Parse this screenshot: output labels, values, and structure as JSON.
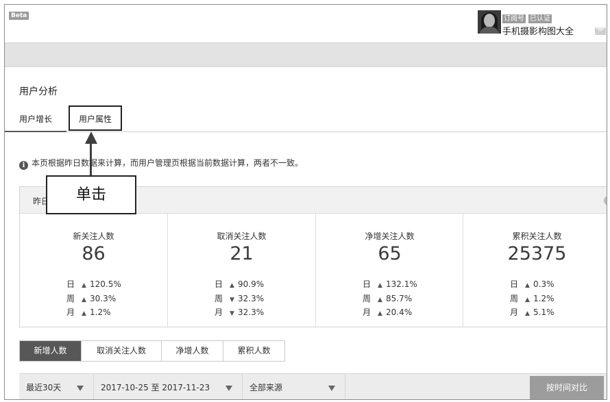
{
  "header": {
    "beta_label": "Beta",
    "tags": [
      "订阅号",
      "已认证"
    ],
    "account_name": "手机摄影构图大全"
  },
  "page_title": "用户分析",
  "tabs": [
    {
      "label": "用户增长"
    },
    {
      "label": "用户属性"
    }
  ],
  "callout_text": "单击",
  "notice": "本页根据昨日数据来计算，而用户管理页根据当前数据计算，两者不一致。",
  "panel": {
    "title": "昨日",
    "help_icon": "?"
  },
  "stats": [
    {
      "label": "新关注人数",
      "value": "86",
      "rows": [
        {
          "period": "日",
          "dir": "▲",
          "pct": "120.5%"
        },
        {
          "period": "周",
          "dir": "▲",
          "pct": "30.3%"
        },
        {
          "period": "月",
          "dir": "▲",
          "pct": "1.2%"
        }
      ]
    },
    {
      "label": "取消关注人数",
      "value": "21",
      "rows": [
        {
          "period": "日",
          "dir": "▲",
          "pct": "90.9%"
        },
        {
          "period": "周",
          "dir": "▼",
          "pct": "32.3%"
        },
        {
          "period": "月",
          "dir": "▼",
          "pct": "32.3%"
        }
      ]
    },
    {
      "label": "净增关注人数",
      "value": "65",
      "rows": [
        {
          "period": "日",
          "dir": "▲",
          "pct": "132.1%"
        },
        {
          "period": "周",
          "dir": "▲",
          "pct": "85.7%"
        },
        {
          "period": "月",
          "dir": "▲",
          "pct": "20.4%"
        }
      ]
    },
    {
      "label": "累积关注人数",
      "value": "25375",
      "rows": [
        {
          "period": "日",
          "dir": "▲",
          "pct": "0.3%"
        },
        {
          "period": "周",
          "dir": "▲",
          "pct": "1.2%"
        },
        {
          "period": "月",
          "dir": "▲",
          "pct": "5.1%"
        }
      ]
    }
  ],
  "segment_tabs": [
    "新增人数",
    "取消关注人数",
    "净增人数",
    "累积人数"
  ],
  "filters": {
    "range": "最近30天",
    "dates": "2017-10-25 至 2017-11-23",
    "source": "全部来源",
    "compare_button": "按时间对比"
  },
  "icons": {
    "info": "info-icon",
    "help": "help-icon",
    "mail": "mail-icon",
    "caret": "caret-down-icon"
  }
}
